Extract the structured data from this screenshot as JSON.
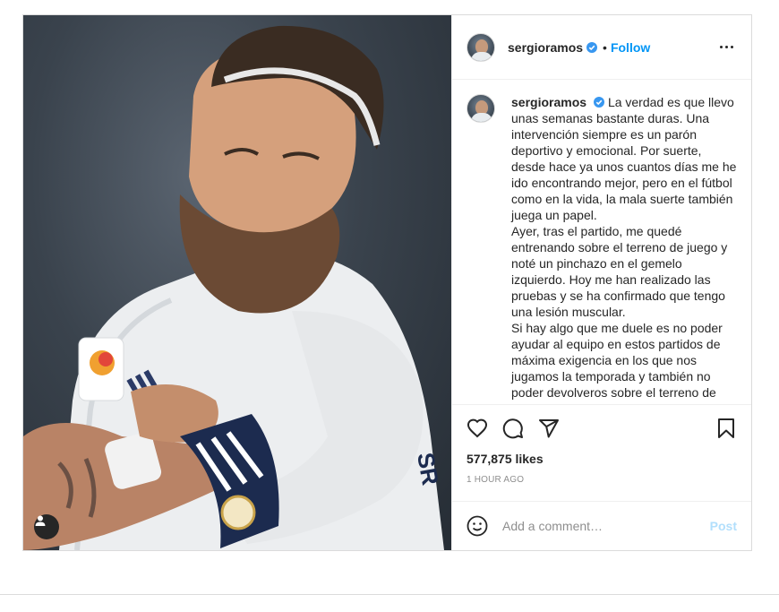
{
  "post": {
    "author": "sergioramos",
    "verified": true,
    "follow_label": "Follow",
    "separator": "•",
    "caption_paragraphs": [
      "La verdad es que llevo unas semanas bastante duras. Una intervención siempre es un parón deportivo y emocional. Por suerte, desde hace ya unos cuantos días me he ido encontrando mejor, pero en el fútbol como en la vida, la mala suerte también juega un papel.",
      "Ayer, tras el partido, me quedé entrenando sobre el terreno de juego y noté un pinchazo en el gemelo izquierdo. Hoy me han realizado las pruebas y se ha confirmado que tengo una lesión muscular.",
      "Si hay algo que me duele es no poder ayudar al equipo en estos partidos de máxima exigencia en los que nos jugamos la temporada y también no poder devolveros sobre el terreno de"
    ],
    "likes": "577,875 likes",
    "time_ago": "1 HOUR AGO",
    "comment_placeholder": "Add a comment…",
    "post_button": "Post"
  },
  "icons": {
    "verified": "verified-badge-icon",
    "more": "more-options-icon",
    "like": "heart-icon",
    "comment": "comment-bubble-icon",
    "share": "paper-plane-icon",
    "save": "bookmark-icon",
    "emoji": "smiley-icon",
    "user_tag": "user-tag-icon"
  },
  "colors": {
    "accent": "#0095f6",
    "verified": "#3897f0",
    "post_disabled": "#b2dffc",
    "muted": "#8e8e8e"
  }
}
